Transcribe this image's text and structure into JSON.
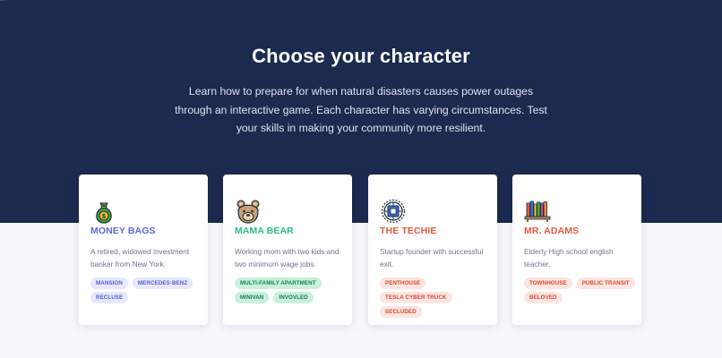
{
  "header": {
    "title": "Choose your character",
    "subtitle": "Learn how to prepare for when natural disasters causes power outages through an interactive game. Each character has varying circumstances. Test your skills in making your community more resilient."
  },
  "colors": {
    "hero_background": "#1b2a4e",
    "page_background": "#f7f8fc",
    "blue_accent": "#5b6ad6",
    "green_accent": "#2ebf83",
    "red_accent": "#e9573f"
  },
  "characters": [
    {
      "name": "MONEY BAGS",
      "icon": "money-bag-icon",
      "description": "A retired, widowed investment banker from New York.",
      "tags": [
        "MANSION",
        "MERCEDES-BENZ",
        "RECLUSE"
      ],
      "accent": "blue"
    },
    {
      "name": "MAMA BEAR",
      "icon": "bear-icon",
      "description": "Working mom with two kids and two minimum wage jobs.",
      "tags": [
        "MULTI-FAMILY APARTMENT",
        "MINIVAN",
        "INVOVLED"
      ],
      "accent": "green"
    },
    {
      "name": "THE TECHIE",
      "icon": "processor-icon",
      "description": "Startup founder with successful exit.",
      "tags": [
        "PENTHOUSE",
        "TESLA CYBER TRUCK",
        "SECLUDED"
      ],
      "accent": "red"
    },
    {
      "name": "MR. ADAMS",
      "icon": "bookshelf-icon",
      "description": "Elderly High school english teacher.",
      "tags": [
        "TOWNHOUSE",
        "PUBLIC TRANSIT",
        "BELOVED"
      ],
      "accent": "red"
    }
  ]
}
